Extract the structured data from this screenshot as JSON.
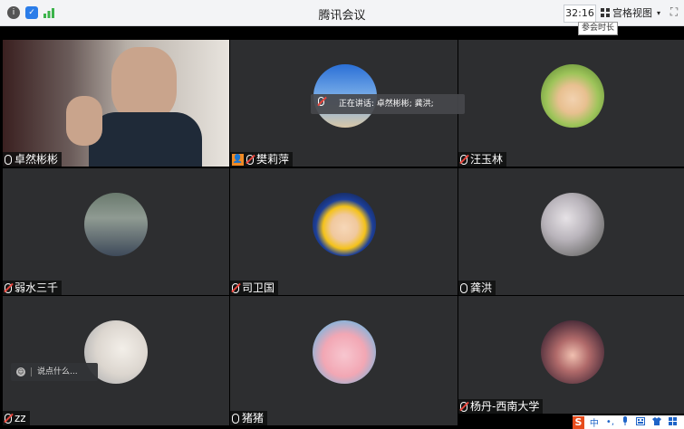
{
  "window": {
    "title": "腾讯会议"
  },
  "toolbar": {
    "timer": "32:16",
    "timer_tooltip": "参会时长",
    "view_label": "宫格视图",
    "view_caret": "▾",
    "fullscreen": "⛶"
  },
  "speaking": {
    "label": "正在讲话: 卓然彬彬; 龚洪;"
  },
  "chat": {
    "placeholder": "说点什么..."
  },
  "participants": [
    {
      "name": "卓然彬彬"
    },
    {
      "name": "樊莉萍"
    },
    {
      "name": "汪玉林"
    },
    {
      "name": "弱水三千"
    },
    {
      "name": "司卫国"
    },
    {
      "name": "龚洪"
    },
    {
      "name": "zz"
    },
    {
      "name": "猪猪"
    },
    {
      "name": "杨丹-西南大学"
    }
  ],
  "tray": {
    "logo": "S",
    "lang": "中",
    "dot": "•,"
  },
  "colors": {
    "tile_bg": "#2d2e30",
    "muted_red": "#e8453c",
    "brand_orange": "#f08a24",
    "titlebar_bg": "#f3f4f6"
  }
}
